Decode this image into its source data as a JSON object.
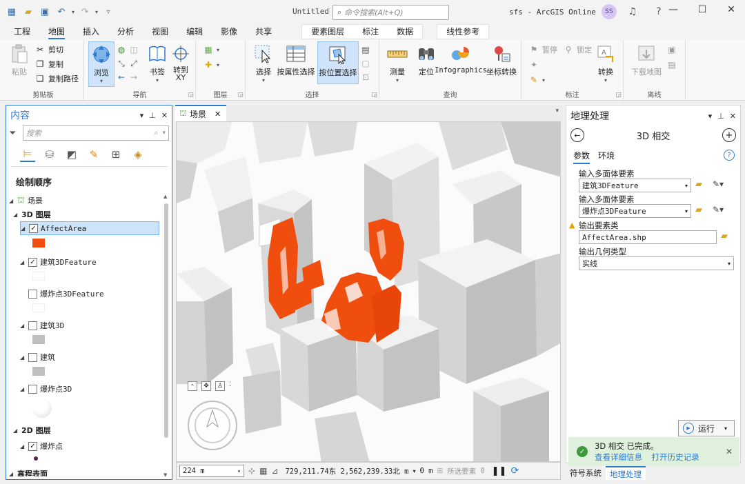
{
  "titlebar": {
    "doc_title": "Untitled",
    "search_placeholder": "命令搜索(Alt+Q)",
    "user": "sfs - ArcGIS Online",
    "avatar_initials": "SS",
    "help": "?"
  },
  "ribbon_tabs": [
    "工程",
    "地图",
    "插入",
    "分析",
    "视图",
    "编辑",
    "影像",
    "共享"
  ],
  "context_tabs": [
    "要素图层",
    "标注",
    "数据"
  ],
  "context_tabs2": [
    "线性参考"
  ],
  "ribbon": {
    "clipboard": {
      "label": "剪贴板",
      "paste": "粘贴",
      "cut": "剪切",
      "copy": "复制",
      "copy_path": "复制路径"
    },
    "navigate": {
      "label": "导航",
      "explore": "浏览",
      "bookmarks": "书签",
      "goto_xy": "转到\nXY"
    },
    "layer": {
      "label": "图层"
    },
    "selection": {
      "label": "选择",
      "select": "选择",
      "by_attr": "按属性选择",
      "by_loc": "按位置选择"
    },
    "inquiry": {
      "label": "查询",
      "measure": "测量",
      "locate": "定位",
      "infographics": "Infographics",
      "coord_conv": "坐标转换"
    },
    "labeling": {
      "label": "标注",
      "pause": "暂停",
      "lock": "锁定",
      "convert": "转换"
    },
    "offline": {
      "label": "离线",
      "download": "下载地图"
    }
  },
  "contents": {
    "title": "内容",
    "search_placeholder": "搜索",
    "draw_order": "绘制顺序",
    "scene": "场景",
    "group_3d": "3D 图层",
    "group_2d": "2D 图层",
    "layers_3d": [
      {
        "name": "AffectArea",
        "checked": true,
        "color": "#f04e0f"
      },
      {
        "name": "建筑3DFeature",
        "checked": true,
        "color": "#ffffff"
      },
      {
        "name": "爆炸点3DFeature",
        "checked": false,
        "color": "#ffffff"
      },
      {
        "name": "建筑3D",
        "checked": false,
        "color": "#bfbfbf"
      },
      {
        "name": "建筑",
        "checked": false,
        "color": "#bfbfbf"
      },
      {
        "name": "爆炸点3D",
        "checked": false,
        "color": "#ffffff"
      }
    ],
    "layers_2d": [
      {
        "name": "爆炸点",
        "checked": true,
        "color": "#5a1f5a"
      }
    ],
    "elevation": "高程表面"
  },
  "view": {
    "tab": "场景",
    "scale": "224 m",
    "coords": "729,211.74东 2,562,239.33北 m",
    "elev": "0 m",
    "selected_label": "所选要素",
    "selected_count": "0"
  },
  "geoprocessing": {
    "title": "地理处理",
    "tool": "3D 相交",
    "tabs": [
      "参数",
      "环境"
    ],
    "in1_label": "输入多面体要素",
    "in1_value": "建筑3DFeature",
    "in2_label": "输入多面体要素",
    "in2_value": "爆炸点3DFeature",
    "out_label": "输出要素类",
    "out_value": "AffectArea.shp",
    "geom_label": "输出几何类型",
    "geom_value": "实线",
    "run": "运行",
    "status": "3D 相交 已完成。",
    "details": "查看详细信息",
    "history": "打开历史记录"
  },
  "bottom_tabs": [
    "符号系统",
    "地理处理"
  ],
  "colors": {
    "accent": "#2b79d0",
    "affect": "#f04e0f",
    "success_bg": "#dff0dc"
  }
}
